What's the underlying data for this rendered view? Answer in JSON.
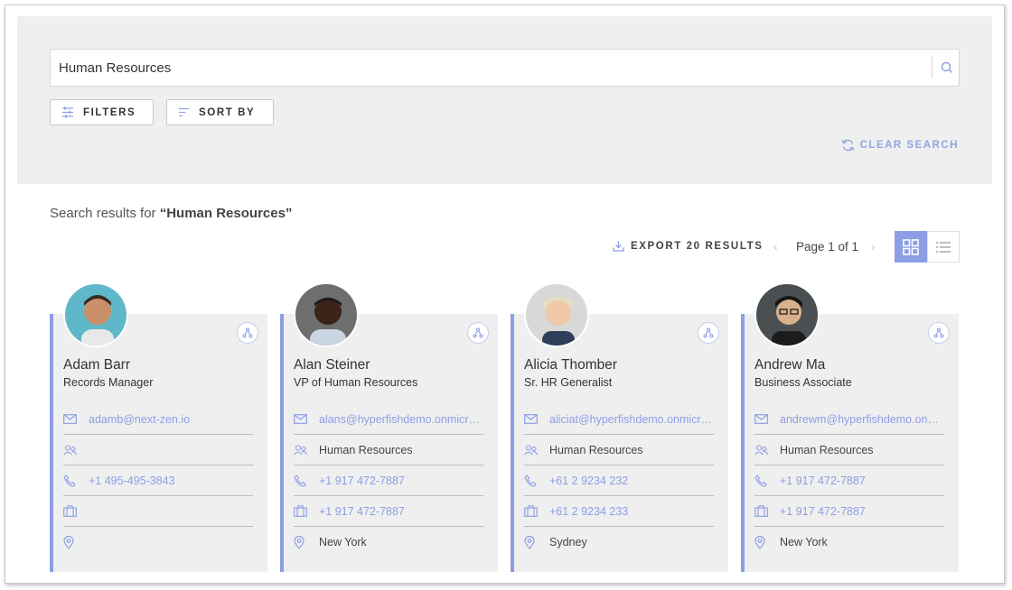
{
  "search": {
    "value": "Human Resources",
    "placeholder": "Search"
  },
  "buttons": {
    "filters": "FILTERS",
    "sort_by": "SORT BY",
    "clear_search": "CLEAR SEARCH"
  },
  "results": {
    "prefix": "Search results for ",
    "query": "“Human Resources”",
    "export": "EXPORT 20 RESULTS",
    "page": "Page 1 of 1"
  },
  "colors": {
    "accent": "#8c9ee5",
    "panel": "#efefef"
  },
  "people": [
    {
      "name": "Adam Barr",
      "title": "Records Manager",
      "email": "adamb@next-zen.io",
      "department": "",
      "phone": "+1 495-495-3843",
      "work_phone": "",
      "location": ""
    },
    {
      "name": "Alan Steiner",
      "title": "VP of Human Resources",
      "email": "alans@hyperfishdemo.onmicros...",
      "department": "Human Resources",
      "phone": "+1 917 472-7887",
      "work_phone": "+1 917 472-7887",
      "location": "New York"
    },
    {
      "name": "Alicia Thomber",
      "title": "Sr. HR Generalist",
      "email": "aliciat@hyperfishdemo.onmicros...",
      "department": "Human Resources",
      "phone": "+61 2 9234 232",
      "work_phone": "+61 2 9234 233",
      "location": "Sydney"
    },
    {
      "name": "Andrew Ma",
      "title": "Business Associate",
      "email": "andrewm@hyperfishdemo.onmi...",
      "department": "Human Resources",
      "phone": "+1 917 472-7887",
      "work_phone": "+1 917 472-7887",
      "location": "New York"
    }
  ]
}
